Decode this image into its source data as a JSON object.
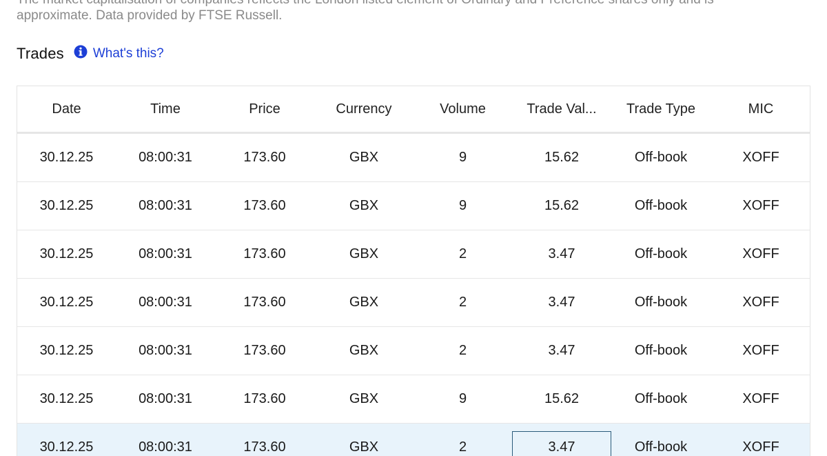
{
  "disclaimer": {
    "line1": "The market capitalisation of companies reflects the London listed element of Ordinary and Preference shares only and is",
    "line2": "approximate. Data provided by FTSE Russell."
  },
  "trades": {
    "title": "Trades",
    "info_icon": "info-circle-icon",
    "whats_this_label": "What's this?",
    "accent_color": "#1d3fd6",
    "columns": [
      "Date",
      "Time",
      "Price",
      "Currency",
      "Volume",
      "Trade Val...",
      "Trade Type",
      "MIC"
    ],
    "rows": [
      [
        "30.12.25",
        "08:00:31",
        "173.60",
        "GBX",
        "9",
        "15.62",
        "Off-book",
        "XOFF"
      ],
      [
        "30.12.25",
        "08:00:31",
        "173.60",
        "GBX",
        "9",
        "15.62",
        "Off-book",
        "XOFF"
      ],
      [
        "30.12.25",
        "08:00:31",
        "173.60",
        "GBX",
        "2",
        "3.47",
        "Off-book",
        "XOFF"
      ],
      [
        "30.12.25",
        "08:00:31",
        "173.60",
        "GBX",
        "2",
        "3.47",
        "Off-book",
        "XOFF"
      ],
      [
        "30.12.25",
        "08:00:31",
        "173.60",
        "GBX",
        "2",
        "3.47",
        "Off-book",
        "XOFF"
      ],
      [
        "30.12.25",
        "08:00:31",
        "173.60",
        "GBX",
        "9",
        "15.62",
        "Off-book",
        "XOFF"
      ],
      [
        "30.12.25",
        "08:00:31",
        "173.60",
        "GBX",
        "2",
        "3.47",
        "Off-book",
        "XOFF"
      ]
    ],
    "selected_row_index": 6,
    "selected_row_color": "#e8f3fb"
  }
}
